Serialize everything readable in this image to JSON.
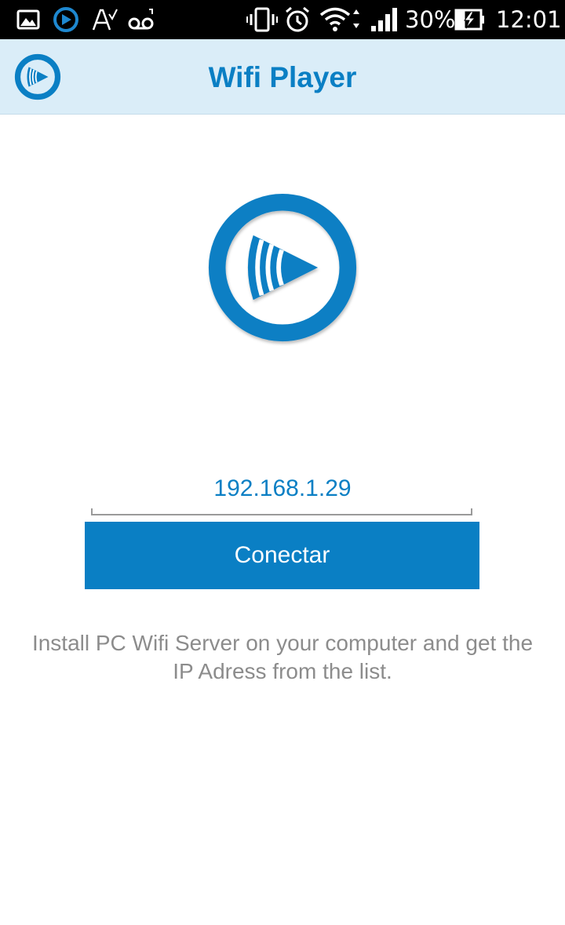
{
  "status_bar": {
    "icons": [
      "gallery-icon",
      "wifi-player-notification-icon",
      "spellcheck-icon",
      "voicemail-icon",
      "vibrate-icon",
      "alarm-icon",
      "wifi-icon",
      "signal-icon",
      "battery-charging-icon"
    ],
    "battery_percent": "30%",
    "time": "12:01"
  },
  "app_bar": {
    "title": "Wifi Player",
    "logo_icon": "wifi-player-logo-icon"
  },
  "main": {
    "hero_icon": "wifi-player-logo-icon",
    "ip_value": "192.168.1.29",
    "connect_label": "Conectar",
    "instructions": "Install PC Wifi Server on your computer and get the IP Adress from the list."
  },
  "colors": {
    "accent": "#0a7fc4",
    "app_bar_bg": "#daedf8",
    "status_bar_bg": "#000000",
    "instruction_text": "#8c8c8c"
  }
}
